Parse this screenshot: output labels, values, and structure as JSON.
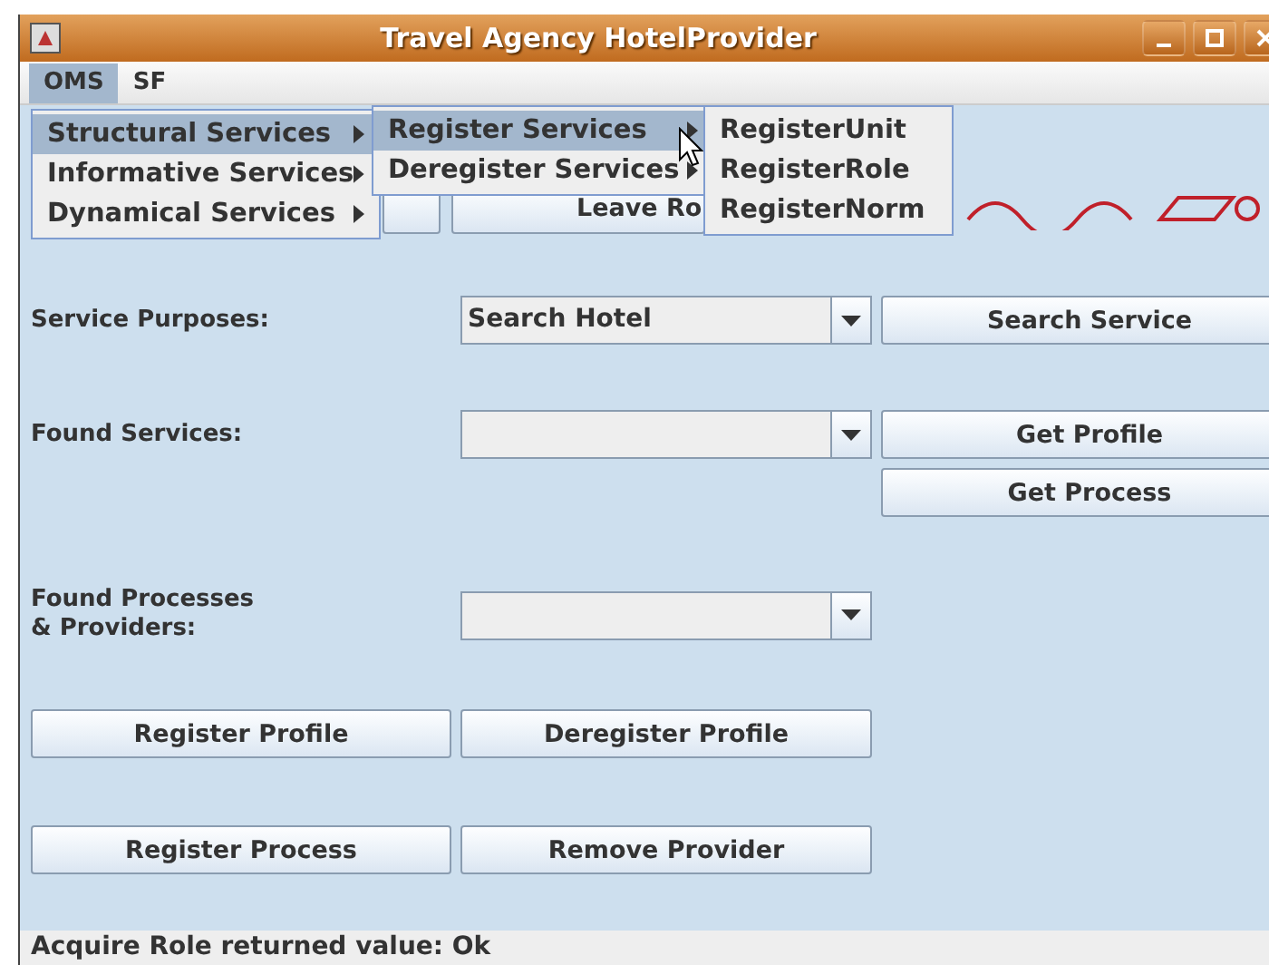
{
  "window": {
    "title": "Travel Agency HotelProvider"
  },
  "menu_bar": [
    {
      "label": "OMS",
      "selected": true
    },
    {
      "label": "SF",
      "selected": false
    }
  ],
  "open_menus": [
    [
      {
        "label": "Structural Services",
        "selected": true,
        "has_submenu": true
      },
      {
        "label": "Informative Services",
        "selected": false,
        "has_submenu": true
      },
      {
        "label": "Dynamical Services",
        "selected": false,
        "has_submenu": true
      }
    ],
    [
      {
        "label": "Register Services",
        "selected": true,
        "has_submenu": true
      },
      {
        "label": "Deregister Services",
        "selected": false,
        "has_submenu": true
      }
    ],
    [
      {
        "label": "RegisterUnit",
        "selected": false,
        "has_submenu": false
      },
      {
        "label": "RegisterRole",
        "selected": false,
        "has_submenu": false
      },
      {
        "label": "RegisterNorm",
        "selected": false,
        "has_submenu": false
      }
    ]
  ],
  "role_buttons": [
    "Leave Ro"
  ],
  "service_purposes": {
    "label": "Service Purposes:",
    "value": "Search Hotel",
    "button": "Search Service"
  },
  "found_services": {
    "label": "Found Services:",
    "buttons": [
      "Get Profile",
      "Get Process"
    ]
  },
  "found_processes": {
    "label_lines": [
      "Found Processes",
      "& Providers:"
    ]
  },
  "profile_buttons": [
    "Register Profile",
    "Deregister Profile"
  ],
  "process_buttons": [
    "Register Process",
    "Remove Provider"
  ],
  "status_bar": "Acquire Role returned value: Ok"
}
